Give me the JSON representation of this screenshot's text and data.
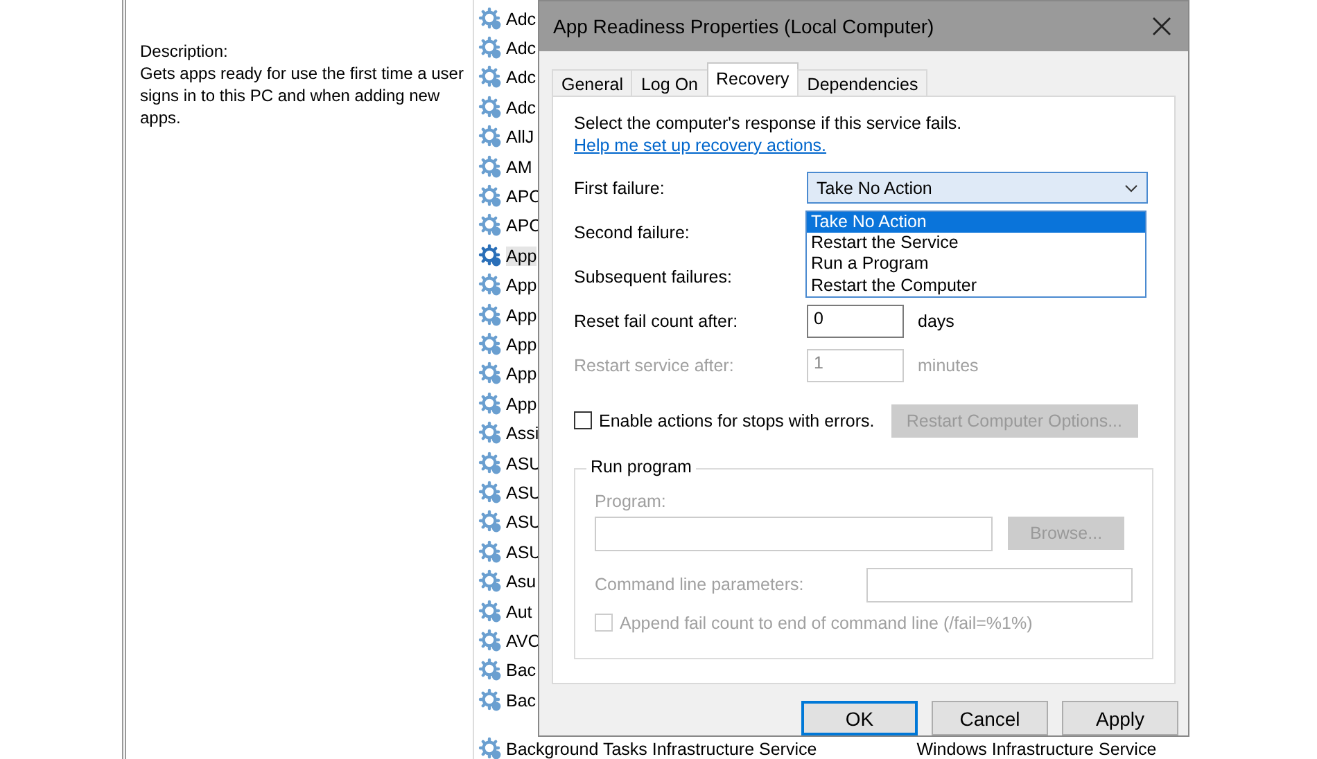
{
  "description": {
    "label": "Description:",
    "text": "Gets apps ready for use the first time a user signs in to this PC and when adding new apps."
  },
  "services": [
    {
      "name": "Adc",
      "selected": false
    },
    {
      "name": "Adc",
      "selected": false
    },
    {
      "name": "Adc",
      "selected": false
    },
    {
      "name": "Adc",
      "selected": false
    },
    {
      "name": "AllJ",
      "selected": false
    },
    {
      "name": "AM",
      "selected": false
    },
    {
      "name": "APC",
      "selected": false
    },
    {
      "name": "APC",
      "selected": false
    },
    {
      "name": "App",
      "selected": true
    },
    {
      "name": "App",
      "selected": false
    },
    {
      "name": "App",
      "selected": false
    },
    {
      "name": "App",
      "selected": false
    },
    {
      "name": "App",
      "selected": false
    },
    {
      "name": "App",
      "selected": false
    },
    {
      "name": "Assi",
      "selected": false
    },
    {
      "name": "ASU",
      "selected": false
    },
    {
      "name": "ASU",
      "selected": false
    },
    {
      "name": "ASU",
      "selected": false
    },
    {
      "name": "ASU",
      "selected": false
    },
    {
      "name": "Asu",
      "selected": false
    },
    {
      "name": "Aut",
      "selected": false
    },
    {
      "name": "AVC",
      "selected": false
    },
    {
      "name": "Bac",
      "selected": false
    },
    {
      "name": "Bac",
      "selected": false
    },
    {
      "name": "Background Tasks Infrastructure Service",
      "selected": false,
      "column_2": "Windows Infrastructure Service"
    }
  ],
  "dialog": {
    "title": "App Readiness Properties (Local Computer)",
    "tabs": [
      {
        "label": "General",
        "selected": false
      },
      {
        "label": "Log On",
        "selected": false
      },
      {
        "label": "Recovery",
        "selected": true
      },
      {
        "label": "Dependencies",
        "selected": false
      }
    ],
    "intro": "Select the computer's response if this service fails.",
    "help_link": "Help me set up recovery actions.",
    "first_failure": {
      "label": "First failure:",
      "value": "Take No Action",
      "expanded": true,
      "options": [
        {
          "label": "Take No Action",
          "selected": true
        },
        {
          "label": "Restart the Service",
          "selected": false
        },
        {
          "label": "Run a Program",
          "selected": false
        },
        {
          "label": "Restart the Computer",
          "selected": false
        }
      ]
    },
    "second_failure": {
      "label": "Second failure:"
    },
    "subsequent_failures": {
      "label": "Subsequent failures:"
    },
    "counters": [
      {
        "label": "Reset fail count after:",
        "value": "0",
        "unit": "days",
        "disabled": false
      },
      {
        "label": "Restart service after:",
        "value": "1",
        "unit": "minutes",
        "disabled": true
      }
    ],
    "enable_actions": {
      "label": "Enable actions for stops with errors.",
      "checked": false
    },
    "restart_options_button": {
      "label": "Restart Computer Options...",
      "disabled": true
    },
    "run_program": {
      "title": "Run program",
      "disabled": true,
      "program_label": "Program:",
      "browse": "Browse...",
      "params_label": "Command line parameters:",
      "append": {
        "label": "Append fail count to end of command line (/fail=%1%)",
        "checked": false
      }
    },
    "buttons": [
      {
        "label": "OK",
        "default": true
      },
      {
        "label": "Cancel",
        "default": false
      },
      {
        "label": "Apply",
        "default": false
      }
    ]
  }
}
